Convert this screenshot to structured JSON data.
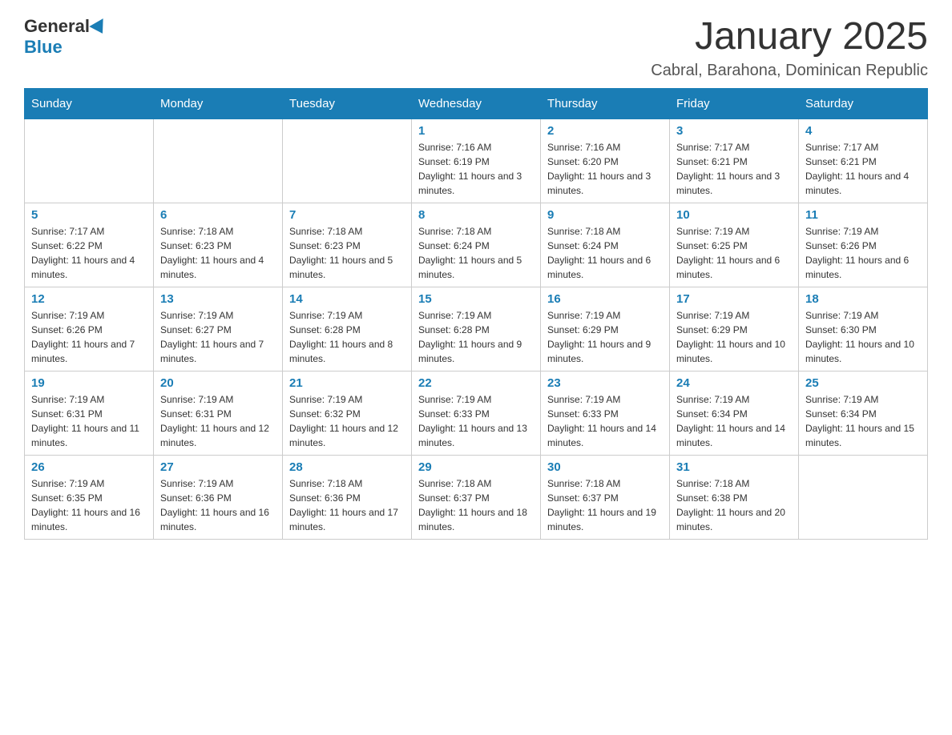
{
  "header": {
    "logo_general": "General",
    "logo_blue": "Blue",
    "month_title": "January 2025",
    "subtitle": "Cabral, Barahona, Dominican Republic"
  },
  "days_of_week": [
    "Sunday",
    "Monday",
    "Tuesday",
    "Wednesday",
    "Thursday",
    "Friday",
    "Saturday"
  ],
  "weeks": [
    [
      {
        "day": "",
        "info": ""
      },
      {
        "day": "",
        "info": ""
      },
      {
        "day": "",
        "info": ""
      },
      {
        "day": "1",
        "info": "Sunrise: 7:16 AM\nSunset: 6:19 PM\nDaylight: 11 hours and 3 minutes."
      },
      {
        "day": "2",
        "info": "Sunrise: 7:16 AM\nSunset: 6:20 PM\nDaylight: 11 hours and 3 minutes."
      },
      {
        "day": "3",
        "info": "Sunrise: 7:17 AM\nSunset: 6:21 PM\nDaylight: 11 hours and 3 minutes."
      },
      {
        "day": "4",
        "info": "Sunrise: 7:17 AM\nSunset: 6:21 PM\nDaylight: 11 hours and 4 minutes."
      }
    ],
    [
      {
        "day": "5",
        "info": "Sunrise: 7:17 AM\nSunset: 6:22 PM\nDaylight: 11 hours and 4 minutes."
      },
      {
        "day": "6",
        "info": "Sunrise: 7:18 AM\nSunset: 6:23 PM\nDaylight: 11 hours and 4 minutes."
      },
      {
        "day": "7",
        "info": "Sunrise: 7:18 AM\nSunset: 6:23 PM\nDaylight: 11 hours and 5 minutes."
      },
      {
        "day": "8",
        "info": "Sunrise: 7:18 AM\nSunset: 6:24 PM\nDaylight: 11 hours and 5 minutes."
      },
      {
        "day": "9",
        "info": "Sunrise: 7:18 AM\nSunset: 6:24 PM\nDaylight: 11 hours and 6 minutes."
      },
      {
        "day": "10",
        "info": "Sunrise: 7:19 AM\nSunset: 6:25 PM\nDaylight: 11 hours and 6 minutes."
      },
      {
        "day": "11",
        "info": "Sunrise: 7:19 AM\nSunset: 6:26 PM\nDaylight: 11 hours and 6 minutes."
      }
    ],
    [
      {
        "day": "12",
        "info": "Sunrise: 7:19 AM\nSunset: 6:26 PM\nDaylight: 11 hours and 7 minutes."
      },
      {
        "day": "13",
        "info": "Sunrise: 7:19 AM\nSunset: 6:27 PM\nDaylight: 11 hours and 7 minutes."
      },
      {
        "day": "14",
        "info": "Sunrise: 7:19 AM\nSunset: 6:28 PM\nDaylight: 11 hours and 8 minutes."
      },
      {
        "day": "15",
        "info": "Sunrise: 7:19 AM\nSunset: 6:28 PM\nDaylight: 11 hours and 9 minutes."
      },
      {
        "day": "16",
        "info": "Sunrise: 7:19 AM\nSunset: 6:29 PM\nDaylight: 11 hours and 9 minutes."
      },
      {
        "day": "17",
        "info": "Sunrise: 7:19 AM\nSunset: 6:29 PM\nDaylight: 11 hours and 10 minutes."
      },
      {
        "day": "18",
        "info": "Sunrise: 7:19 AM\nSunset: 6:30 PM\nDaylight: 11 hours and 10 minutes."
      }
    ],
    [
      {
        "day": "19",
        "info": "Sunrise: 7:19 AM\nSunset: 6:31 PM\nDaylight: 11 hours and 11 minutes."
      },
      {
        "day": "20",
        "info": "Sunrise: 7:19 AM\nSunset: 6:31 PM\nDaylight: 11 hours and 12 minutes."
      },
      {
        "day": "21",
        "info": "Sunrise: 7:19 AM\nSunset: 6:32 PM\nDaylight: 11 hours and 12 minutes."
      },
      {
        "day": "22",
        "info": "Sunrise: 7:19 AM\nSunset: 6:33 PM\nDaylight: 11 hours and 13 minutes."
      },
      {
        "day": "23",
        "info": "Sunrise: 7:19 AM\nSunset: 6:33 PM\nDaylight: 11 hours and 14 minutes."
      },
      {
        "day": "24",
        "info": "Sunrise: 7:19 AM\nSunset: 6:34 PM\nDaylight: 11 hours and 14 minutes."
      },
      {
        "day": "25",
        "info": "Sunrise: 7:19 AM\nSunset: 6:34 PM\nDaylight: 11 hours and 15 minutes."
      }
    ],
    [
      {
        "day": "26",
        "info": "Sunrise: 7:19 AM\nSunset: 6:35 PM\nDaylight: 11 hours and 16 minutes."
      },
      {
        "day": "27",
        "info": "Sunrise: 7:19 AM\nSunset: 6:36 PM\nDaylight: 11 hours and 16 minutes."
      },
      {
        "day": "28",
        "info": "Sunrise: 7:18 AM\nSunset: 6:36 PM\nDaylight: 11 hours and 17 minutes."
      },
      {
        "day": "29",
        "info": "Sunrise: 7:18 AM\nSunset: 6:37 PM\nDaylight: 11 hours and 18 minutes."
      },
      {
        "day": "30",
        "info": "Sunrise: 7:18 AM\nSunset: 6:37 PM\nDaylight: 11 hours and 19 minutes."
      },
      {
        "day": "31",
        "info": "Sunrise: 7:18 AM\nSunset: 6:38 PM\nDaylight: 11 hours and 20 minutes."
      },
      {
        "day": "",
        "info": ""
      }
    ]
  ]
}
